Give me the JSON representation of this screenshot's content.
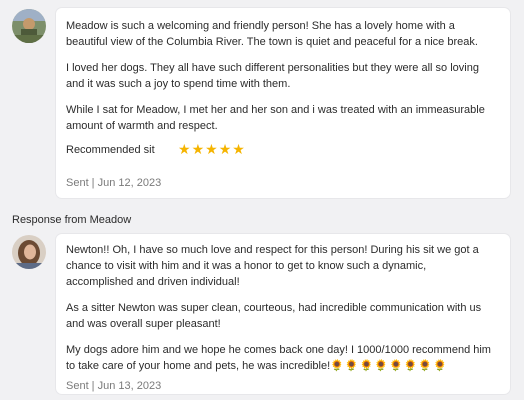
{
  "review": {
    "paragraphs": [
      "Meadow is such a welcoming and friendly person! She has a lovely home with a beautiful view of the Columbia River. The town is quiet and peaceful for a nice break.",
      "I loved her dogs. They all have such different personalities but they were all so loving and it was such a joy to spend time with them.",
      "While I sat for Meadow, I met her and her son and i was treated with an immeasurable amount of warmth and respect."
    ],
    "recommended_label": "Recommended sit",
    "rating": 5,
    "star_glyph": "★",
    "sent": "Sent | Jun 12, 2023"
  },
  "response": {
    "heading": "Response from Meadow",
    "paragraphs": [
      "Newton!! Oh, I have so much love and respect for this person! During his sit we got a chance to visit with him and it was a honor to get to know such a dynamic, accomplished and driven individual!",
      "As a sitter Newton was super clean, courteous, had incredible communication with us and was overall super pleasant!",
      "My dogs adore him and we hope he comes back one day! I 1000/1000 recommend him to take care of your home and pets, he was incredible!"
    ],
    "emoji": "🌻🌻🌻🌻🌻🌻🌻🌻",
    "sent": "Sent | Jun 13, 2023"
  },
  "colors": {
    "star": "#f5b400",
    "background": "#f1f1f3",
    "card": "#ffffff"
  }
}
